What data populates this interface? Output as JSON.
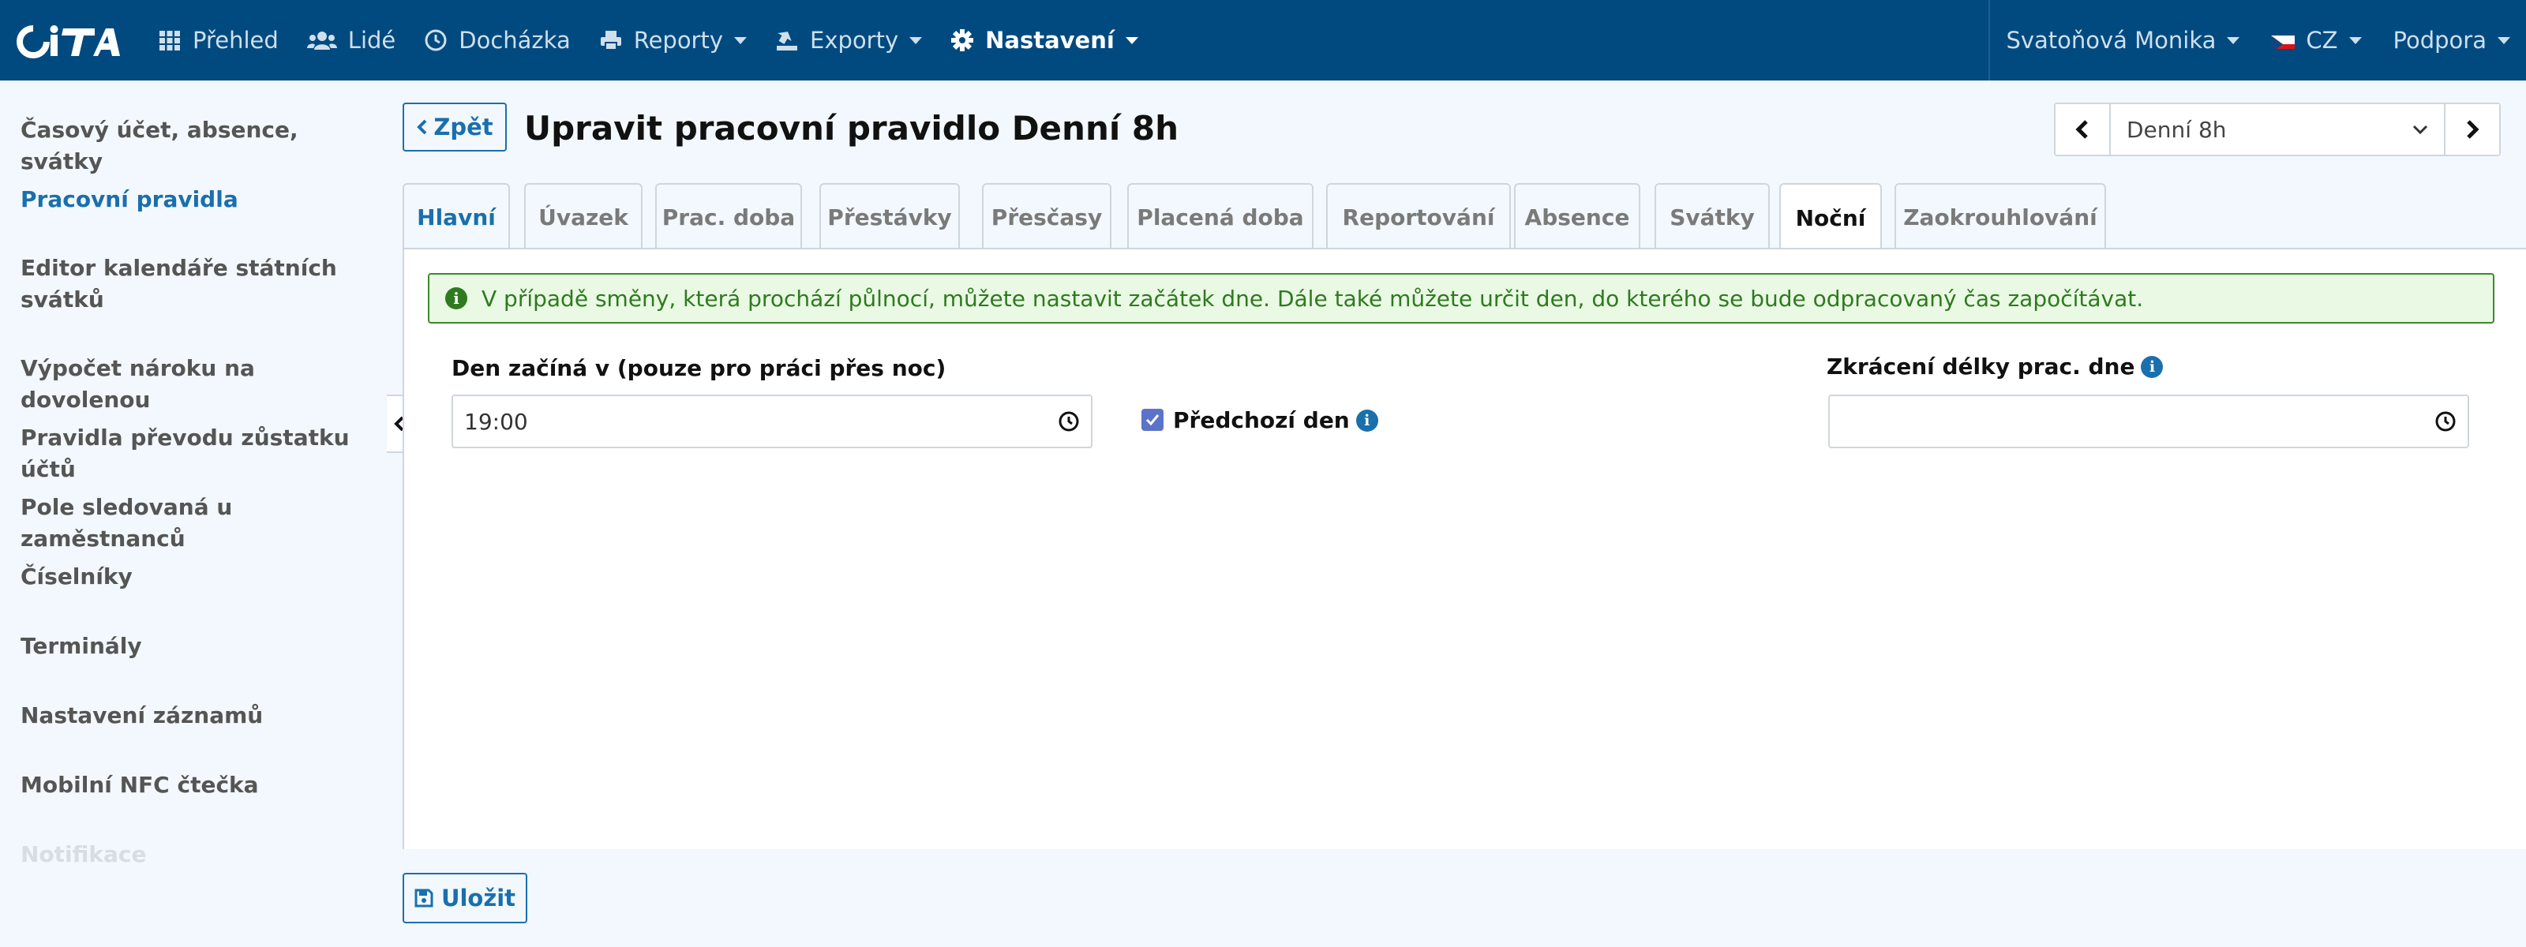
{
  "navbar": {
    "logo_text": "CiTA",
    "items": [
      {
        "label": "Přehled",
        "icon": "grid-icon"
      },
      {
        "label": "Lidé",
        "icon": "users-icon"
      },
      {
        "label": "Docházka",
        "icon": "clock-icon"
      },
      {
        "label": "Reporty",
        "icon": "print-icon"
      },
      {
        "label": "Exporty",
        "icon": "export-icon"
      },
      {
        "label": "Nastavení",
        "icon": "gear-icon"
      }
    ],
    "user_name": "Svatoňová Monika",
    "language": "CZ",
    "support": "Podpora"
  },
  "sidebar": {
    "items": [
      {
        "label": "Časový účet, absence, svátky"
      },
      {
        "label": "Pracovní pravidla"
      },
      {
        "label": "Editor kalendáře státních svátků"
      },
      {
        "label": "Výpočet nároku na dovolenou"
      },
      {
        "label": "Pravidla převodu zůstatku účtů"
      },
      {
        "label": "Pole sledovaná u zaměstnanců"
      },
      {
        "label": "Číselníky"
      },
      {
        "label": "Terminály"
      },
      {
        "label": "Nastavení záznamů"
      },
      {
        "label": "Mobilní NFC čtečka"
      },
      {
        "label": "Notifikace"
      }
    ]
  },
  "header": {
    "back_label": "Zpět",
    "title": "Upravit pracovní pravidlo Denní 8h",
    "selected_rule": "Denní 8h"
  },
  "tabs": [
    {
      "label": "Hlavní"
    },
    {
      "label": "Úvazek"
    },
    {
      "label": "Prac. doba"
    },
    {
      "label": "Přestávky"
    },
    {
      "label": "Přesčasy"
    },
    {
      "label": "Placená doba"
    },
    {
      "label": "Reportování"
    },
    {
      "label": "Absence"
    },
    {
      "label": "Svátky"
    },
    {
      "label": "Noční"
    },
    {
      "label": "Zaokrouhlování"
    }
  ],
  "active_tab": "Noční",
  "alert": {
    "text": "V případě směny, která prochází půlnocí, můžete nastavit začátek dne. Dále také můžete určit den, do kterého se bude odpracovaný čas započítávat."
  },
  "form": {
    "day_start_label": "Den začíná v (pouze pro práci přes noc)",
    "day_start_value": "19:00",
    "previous_day_label": "Předchozí den",
    "previous_day_checked": true,
    "shortening_label": "Zkrácení délky prac. dne",
    "shortening_value": ""
  },
  "footer": {
    "save_label": "Uložit"
  },
  "colors": {
    "navbar": "#004a80",
    "accent": "#1a6fad",
    "alert_bg": "#e9f9e4",
    "alert_text": "#2f7a1f",
    "checkbox": "#5b73c9"
  }
}
